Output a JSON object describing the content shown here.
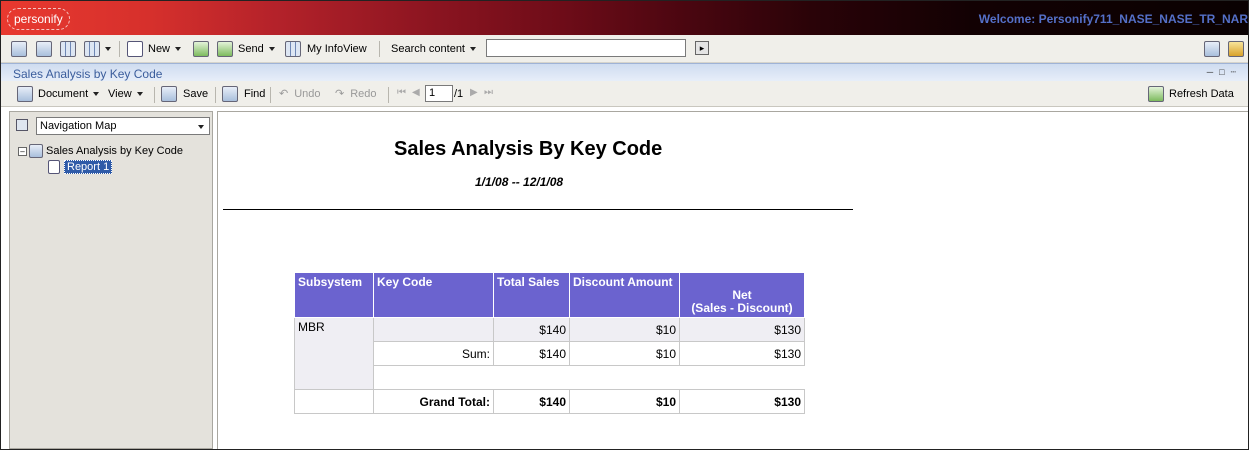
{
  "app": {
    "logo": "personify",
    "welcome": "Welcome: Personify711_NASE_NASE_TR_NAR"
  },
  "toolbar1": {
    "new_label": "New",
    "send_label": "Send",
    "myinfoview_label": "My InfoView",
    "search_label": "Search content",
    "search_value": ""
  },
  "titlebar": {
    "title": "Sales Analysis by Key Code"
  },
  "toolbar2": {
    "document_label": "Document",
    "view_label": "View",
    "save_label": "Save",
    "find_label": "Find",
    "undo_label": "Undo",
    "redo_label": "Redo",
    "page_current": "1",
    "page_total": "/1",
    "refresh_label": "Refresh Data"
  },
  "nav": {
    "select_value": "Navigation Map",
    "tree_root": "Sales Analysis by Key Code",
    "tree_child": "Report 1"
  },
  "report": {
    "title": "Sales Analysis By Key Code",
    "dates": "1/1/08  --  12/1/08",
    "headers": [
      "Subsystem",
      "Key Code",
      "Total Sales",
      "Discount Amount",
      "Net",
      "(Sales - Discount)"
    ],
    "rows": [
      {
        "subsystem": "MBR",
        "key_code": "",
        "total_sales": "$140",
        "discount": "$10",
        "net": "$130"
      },
      {
        "label": "Sum:",
        "total_sales": "$140",
        "discount": "$10",
        "net": "$130"
      }
    ],
    "grand_total": {
      "label": "Grand Total:",
      "total_sales": "$140",
      "discount": "$10",
      "net": "$130"
    }
  }
}
